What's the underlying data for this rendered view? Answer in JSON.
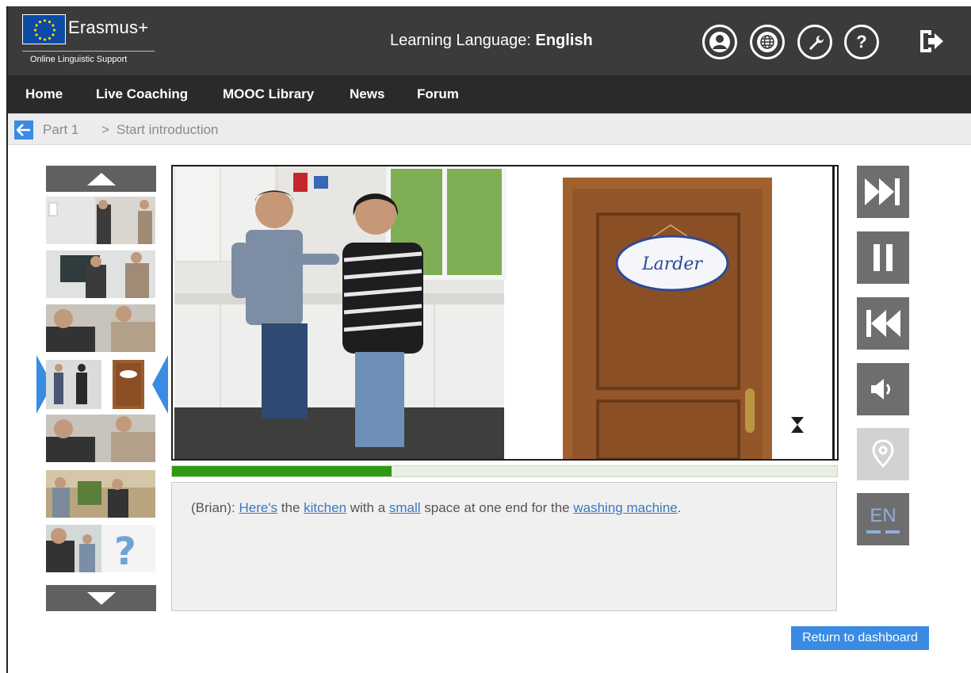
{
  "header": {
    "logo_name": "Erasmus+",
    "logo_subtitle": "Online Linguistic Support",
    "learning_label": "Learning Language: ",
    "learning_value": "English",
    "icons": [
      "user-icon",
      "globe-icon",
      "wrench-icon",
      "help-icon",
      "logout-icon"
    ]
  },
  "nav": {
    "items": [
      "Home",
      "Live Coaching",
      "MOOC Library",
      "News",
      "Forum"
    ]
  },
  "breadcrumb": {
    "part": "Part 1",
    "separator": ">",
    "current": "Start introduction"
  },
  "media": {
    "door_sign": "Larder",
    "progress_fraction": 0.33
  },
  "transcript": {
    "speaker": "(Brian): ",
    "segments": [
      {
        "text": "Here's",
        "link": true
      },
      {
        "text": " the ",
        "link": false
      },
      {
        "text": "kitchen",
        "link": true
      },
      {
        "text": " with a ",
        "link": false
      },
      {
        "text": "small",
        "link": true
      },
      {
        "text": " space at one end for the ",
        "link": false
      },
      {
        "text": "washing machine",
        "link": true
      },
      {
        "text": ".",
        "link": false
      }
    ]
  },
  "controls": {
    "buttons": [
      "skip-forward-icon",
      "pause-icon",
      "rewind-icon",
      "volume-icon",
      "location-pin-icon"
    ],
    "language": "EN"
  },
  "footer": {
    "return_label": "Return to dashboard"
  },
  "colors": {
    "header_bg": "#3b3b3b",
    "nav_bg": "#2a2a2a",
    "accent": "#3a8be3",
    "progress": "#2f9a14",
    "link": "#3a77c2"
  }
}
